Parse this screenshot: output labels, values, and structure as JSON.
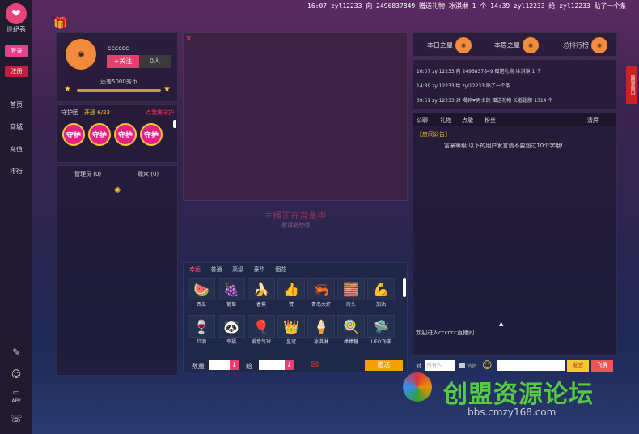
{
  "brand": {
    "name": "世纪秀",
    "logo_glyph": "❤"
  },
  "auth": {
    "login": "登录",
    "register": "注册"
  },
  "nav": [
    "首页",
    "商城",
    "充值",
    "排行"
  ],
  "ticker": "16:07  zyl12233  向  2496837849  赠送礼物  冰淇淋  1  个   14:39  zyl12233  给  zyl12233  贴了一个条",
  "anchor": {
    "name": "cccccc",
    "follow": "+关注",
    "fans": "0人",
    "upgrade_text": "还差5000秀币"
  },
  "guard": {
    "title": "守护团",
    "open": "开通 6/23",
    "link": "点我做守护",
    "badge": "守护",
    "count": 4
  },
  "members": {
    "admin": "管理员 (0)",
    "viewers": "观众 (0)"
  },
  "video": {
    "notice": "主播正在准备中",
    "sub": "敬请期待哦"
  },
  "gifts": {
    "tabs": [
      "幸运",
      "普通",
      "高级",
      "豪华",
      "烟花"
    ],
    "items": [
      {
        "name": "西瓜",
        "icon": "🍉"
      },
      {
        "name": "葡萄",
        "icon": "🍇"
      },
      {
        "name": "香蕉",
        "icon": "🍌"
      },
      {
        "name": "赞",
        "icon": "👍"
      },
      {
        "name": "青岛大虾",
        "icon": "🦐"
      },
      {
        "name": "砖头",
        "icon": "🧱"
      },
      {
        "name": "加油",
        "icon": "💪"
      },
      {
        "name": "红酒",
        "icon": "🍷"
      },
      {
        "name": "幸福",
        "icon": "🐼"
      },
      {
        "name": "爱意气球",
        "icon": "🎈"
      },
      {
        "name": "皇冠",
        "icon": "👑"
      },
      {
        "name": "冰淇淋",
        "icon": "🍦"
      },
      {
        "name": "棒棒糖",
        "icon": "🍭"
      },
      {
        "name": "UFO飞碟",
        "icon": "🛸"
      }
    ],
    "qty_label": "数量",
    "to_label": "给",
    "send": "赠送"
  },
  "ranks": {
    "tabs": [
      "本日之星",
      "本周之星",
      "总排行榜"
    ],
    "side": "回到首页"
  },
  "feed": [
    "16:07  zyl12233  向  2496837849  赠送礼物  冰淇淋  1  个",
    "14:39  zyl12233  给  zyl12233  贴了一个条",
    "09:51  zyl12233  对  喝醉❤男士的  赠送礼物  长着翅膀  1314  个"
  ],
  "chat": {
    "tabs": [
      "公聊",
      "礼物",
      "点歌",
      "粉丝"
    ],
    "clear": "清屏",
    "notice_tag": "【房间公告】",
    "notice": "富豪等级:以下的用户发言请不要超过10个字哦!",
    "welcome": "欢迎进入cccccc直播间",
    "to_label": "对",
    "to_value": "所有人",
    "private": "悄悄",
    "send": "发言",
    "fly": "飞屏"
  },
  "watermark": {
    "cn": "创盟资源论坛",
    "url": "bbs.cmzy168.com"
  }
}
